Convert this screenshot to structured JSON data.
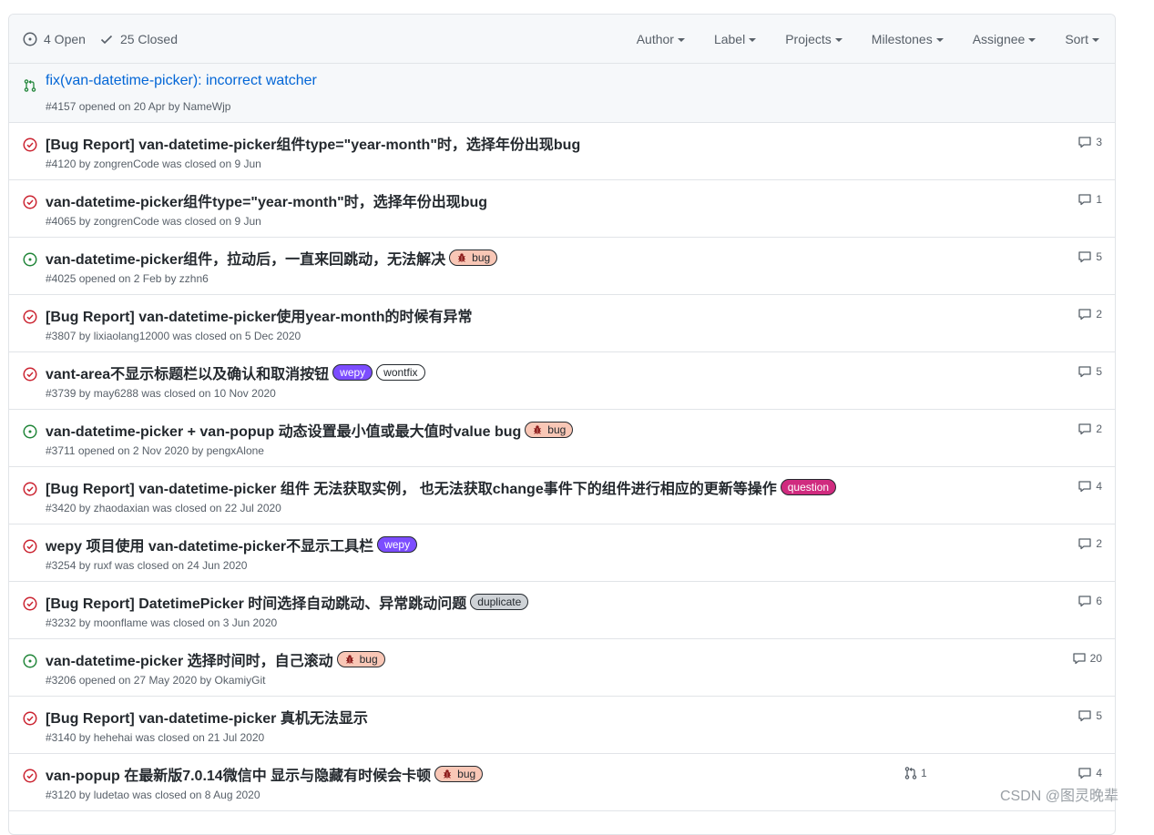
{
  "header": {
    "open_label": "4 Open",
    "closed_label": "25 Closed",
    "filters": [
      "Author",
      "Label",
      "Projects",
      "Milestones",
      "Assignee",
      "Sort"
    ]
  },
  "pinned_pr": {
    "title": "fix(van-datetime-picker): incorrect watcher",
    "meta": "#4157 opened on 20 Apr by NameWjp"
  },
  "issues": [
    {
      "state": "closed",
      "title": "[Bug Report] van-datetime-picker组件type=\"year-month\"时，选择年份出现bug",
      "labels": [],
      "meta": "#4120 by zongrenCode was closed on 9 Jun",
      "comments": "3"
    },
    {
      "state": "closed",
      "title": "van-datetime-picker组件type=\"year-month\"时，选择年份出现bug",
      "labels": [],
      "meta": "#4065 by zongrenCode was closed on 9 Jun",
      "comments": "1"
    },
    {
      "state": "open",
      "title": "van-datetime-picker组件，拉动后，一直来回跳动，无法解决",
      "labels": [
        "bug"
      ],
      "meta": "#4025 opened on 2 Feb by zzhn6",
      "comments": "5"
    },
    {
      "state": "closed",
      "title": "[Bug Report] van-datetime-picker使用year-month的时候有异常",
      "labels": [],
      "meta": "#3807 by lixiaolang12000 was closed on 5 Dec 2020",
      "comments": "2"
    },
    {
      "state": "closed",
      "title": "vant-area不显示标题栏以及确认和取消按钮",
      "labels": [
        "wepy",
        "wontfix"
      ],
      "meta": "#3739 by may6288 was closed on 10 Nov 2020",
      "comments": "5"
    },
    {
      "state": "open",
      "title": "van-datetime-picker + van-popup 动态设置最小值或最大值时value bug",
      "labels": [
        "bug"
      ],
      "meta": "#3711 opened on 2 Nov 2020 by pengxAlone",
      "comments": "2"
    },
    {
      "state": "closed",
      "title": "[Bug Report] van-datetime-picker 组件 无法获取实例， 也无法获取change事件下的组件进行相应的更新等操作",
      "labels": [
        "question"
      ],
      "meta": "#3420 by zhaodaxian was closed on 22 Jul 2020",
      "comments": "4"
    },
    {
      "state": "closed",
      "title": "wepy 项目使用 van-datetime-picker不显示工具栏",
      "labels": [
        "wepy"
      ],
      "meta": "#3254 by ruxf was closed on 24 Jun 2020",
      "comments": "2"
    },
    {
      "state": "closed",
      "title": "[Bug Report] DatetimePicker 时间选择自动跳动、异常跳动问题",
      "labels": [
        "duplicate"
      ],
      "meta": "#3232 by moonflame was closed on 3 Jun 2020",
      "comments": "6"
    },
    {
      "state": "open",
      "title": "van-datetime-picker 选择时间时，自己滚动",
      "labels": [
        "bug"
      ],
      "meta": "#3206 opened on 27 May 2020 by OkamiyGit",
      "comments": "20"
    },
    {
      "state": "closed",
      "title": "[Bug Report] van-datetime-picker 真机无法显示",
      "labels": [],
      "meta": "#3140 by hehehai was closed on 21 Jul 2020",
      "comments": "5"
    },
    {
      "state": "closed",
      "title": "van-popup 在最新版7.0.14微信中 显示与隐藏有时候会卡顿",
      "labels": [
        "bug"
      ],
      "meta": "#3120 by ludetao was closed on 8 Aug 2020",
      "comments": "4",
      "linked_prs": "1"
    }
  ],
  "watermark": "CSDN @图灵晚辈",
  "colors": {
    "open": "#22863a",
    "closed": "#cb2431",
    "link": "#0366d6",
    "bug": "#f9c7b6",
    "wepy": "#7c4dff",
    "question": "#d02b7f",
    "duplicate": "#cfd3d7"
  }
}
